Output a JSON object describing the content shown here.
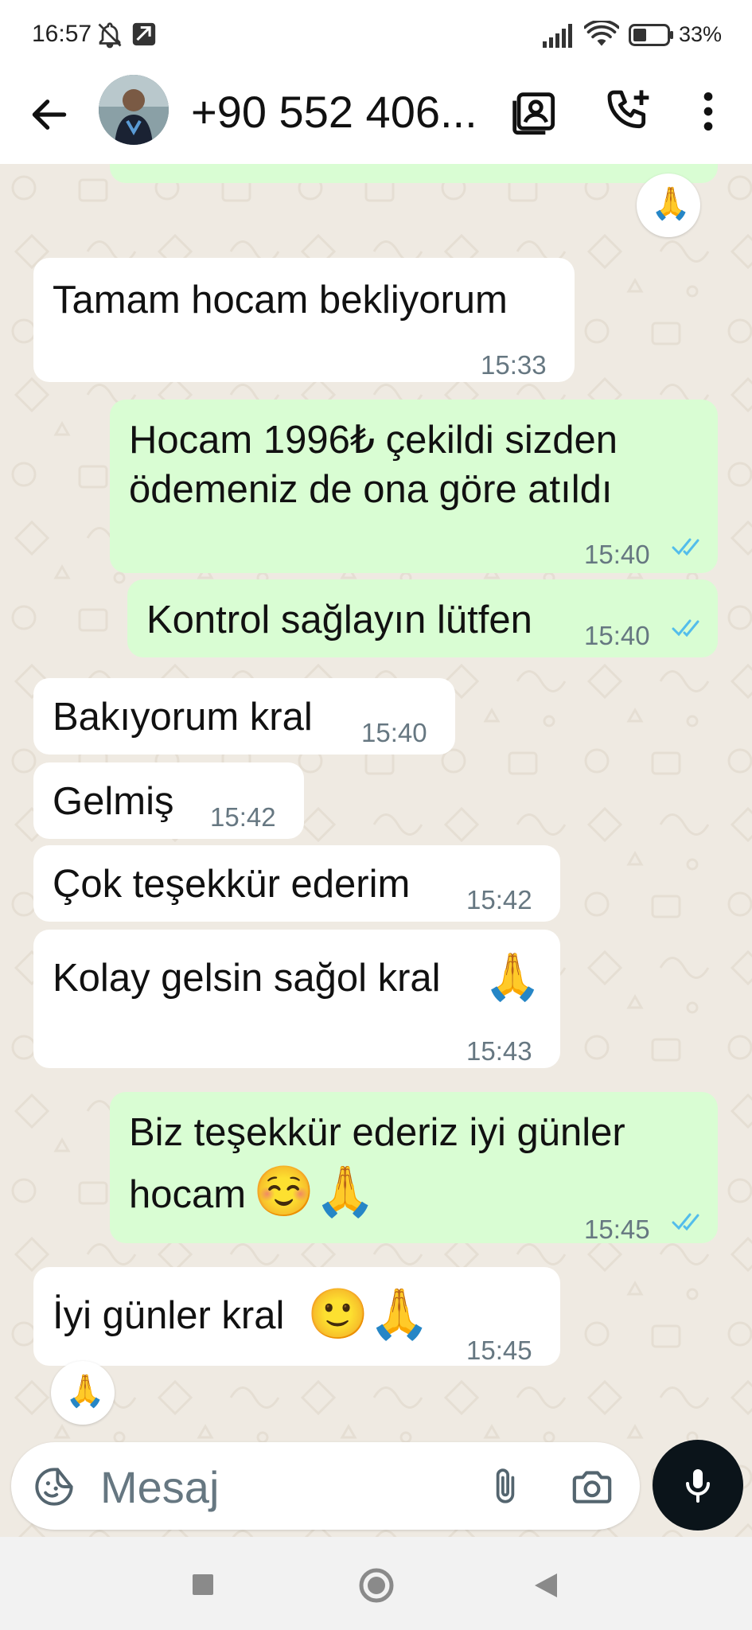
{
  "status_bar": {
    "time": "16:57",
    "battery": "33%"
  },
  "header": {
    "contact_name": "+90 552 406...",
    "icons": [
      "back-arrow-icon",
      "contact-card-icon",
      "add-call-icon",
      "more-vertical-icon"
    ]
  },
  "messages": [
    {
      "dir": "out",
      "text": "",
      "time": "",
      "partial": true
    },
    {
      "dir": "out",
      "reaction": "🙏"
    },
    {
      "dir": "in",
      "text": "Tamam hocam bekliyorum",
      "time": "15:33"
    },
    {
      "dir": "out",
      "lines": [
        "Hocam 1996₺ çekildi sizden",
        "ödemeniz de ona göre atıldı"
      ],
      "time": "15:40"
    },
    {
      "dir": "out",
      "text": "Kontrol sağlayın lütfen",
      "time": "15:40"
    },
    {
      "dir": "in",
      "text": "Bakıyorum kral",
      "time": "15:40"
    },
    {
      "dir": "in",
      "text": "Gelmiş",
      "time": "15:42"
    },
    {
      "dir": "in",
      "text": "Çok teşekkür ederim",
      "time": "15:42"
    },
    {
      "dir": "in",
      "text": "Kolay gelsin sağol kral",
      "emoji": "🙏",
      "time": "15:43"
    },
    {
      "dir": "out",
      "lines": [
        "Biz teşekkür ederiz iyi günler",
        "hocam"
      ],
      "emoji": "☺️🙏",
      "time": "15:45"
    },
    {
      "dir": "in",
      "text": "İyi günler kral",
      "emoji": "🙂🙏",
      "time": "15:45",
      "reaction": "🙏"
    }
  ],
  "composer": {
    "placeholder": "Mesaj",
    "icons": [
      "sticker-icon",
      "attach-icon",
      "camera-icon",
      "mic-icon"
    ]
  },
  "colors": {
    "incoming": "#ffffff",
    "outgoing": "#d9fdd3",
    "wallpaper": "#efeae2",
    "read_ticks": "#53bdeb",
    "mic_button": "#0b141a"
  }
}
